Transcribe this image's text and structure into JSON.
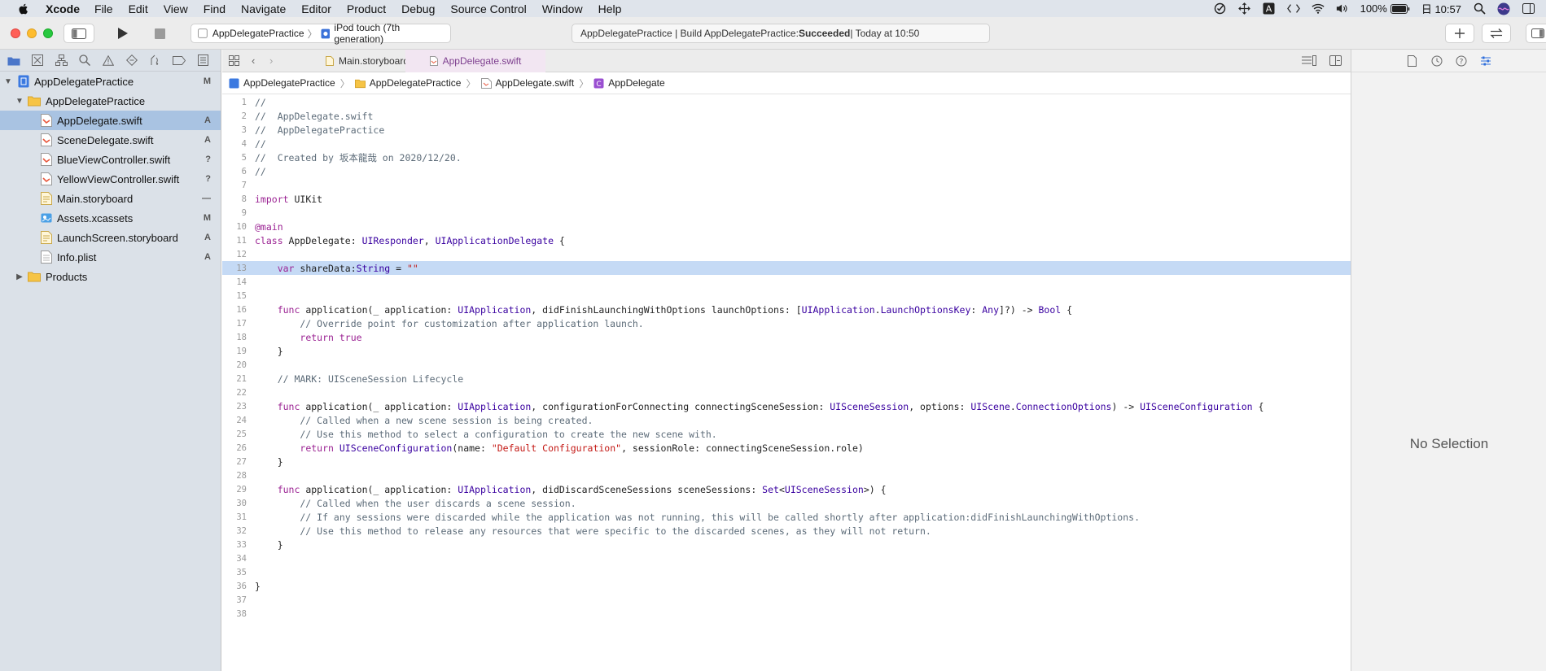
{
  "menubar": {
    "app_name": "Xcode",
    "items": [
      "File",
      "Edit",
      "View",
      "Find",
      "Navigate",
      "Editor",
      "Product",
      "Debug",
      "Source Control",
      "Window",
      "Help"
    ],
    "battery": "100%",
    "clock": "日 10:57"
  },
  "toolbar": {
    "scheme_name": "AppDelegatePractice",
    "device": "iPod touch (7th generation)",
    "activity_prefix": "AppDelegatePractice | Build AppDelegatePractice: ",
    "activity_status": "Succeeded",
    "activity_suffix": " | Today at 10:50"
  },
  "navigator": {
    "project": {
      "label": "AppDelegatePractice",
      "badge": "M"
    },
    "group": {
      "label": "AppDelegatePractice"
    },
    "files": [
      {
        "label": "AppDelegate.swift",
        "badge": "A"
      },
      {
        "label": "SceneDelegate.swift",
        "badge": "A"
      },
      {
        "label": "BlueViewController.swift",
        "badge": "?"
      },
      {
        "label": "YellowViewController.swift",
        "badge": "?"
      },
      {
        "label": "Main.storyboard",
        "badge": "—"
      },
      {
        "label": "Assets.xcassets",
        "badge": "M"
      },
      {
        "label": "LaunchScreen.storyboard",
        "badge": "A"
      },
      {
        "label": "Info.plist",
        "badge": "A"
      }
    ],
    "products": {
      "label": "Products"
    }
  },
  "editor": {
    "tabs": [
      "Main.storyboard",
      "AppDelegate.swift"
    ],
    "jumpbar": [
      "AppDelegatePractice",
      "AppDelegatePractice",
      "AppDelegate.swift",
      "AppDelegate"
    ],
    "highlighted_line": 13,
    "lines": [
      "//",
      "//  AppDelegate.swift",
      "//  AppDelegatePractice",
      "//",
      "//  Created by 坂本龍哉 on 2020/12/20.",
      "//",
      "",
      "import UIKit",
      "",
      "@main",
      "class AppDelegate: UIResponder, UIApplicationDelegate {",
      "",
      "    var shareData:String = \"\"",
      "",
      "",
      "    func application(_ application: UIApplication, didFinishLaunchingWithOptions launchOptions: [UIApplication.LaunchOptionsKey: Any]?) -> Bool {",
      "        // Override point for customization after application launch.",
      "        return true",
      "    }",
      "",
      "    // MARK: UISceneSession Lifecycle",
      "",
      "    func application(_ application: UIApplication, configurationForConnecting connectingSceneSession: UISceneSession, options: UIScene.ConnectionOptions) -> UISceneConfiguration {",
      "        // Called when a new scene session is being created.",
      "        // Use this method to select a configuration to create the new scene with.",
      "        return UISceneConfiguration(name: \"Default Configuration\", sessionRole: connectingSceneSession.role)",
      "    }",
      "",
      "    func application(_ application: UIApplication, didDiscardSceneSessions sceneSessions: Set<UISceneSession>) {",
      "        // Called when the user discards a scene session.",
      "        // If any sessions were discarded while the application was not running, this will be called shortly after application:didFinishLaunchingWithOptions.",
      "        // Use this method to release any resources that were specific to the discarded scenes, as they will not return.",
      "    }",
      "",
      "",
      "}",
      "",
      ""
    ]
  },
  "inspector": {
    "empty_label": "No Selection"
  },
  "colors": {
    "keyword": "#9b2393",
    "type": "#3900a0",
    "comment": "#5d6c79",
    "string": "#c41a16",
    "selection": "#a9c3e2",
    "line_highlight": "#c5daf5"
  }
}
